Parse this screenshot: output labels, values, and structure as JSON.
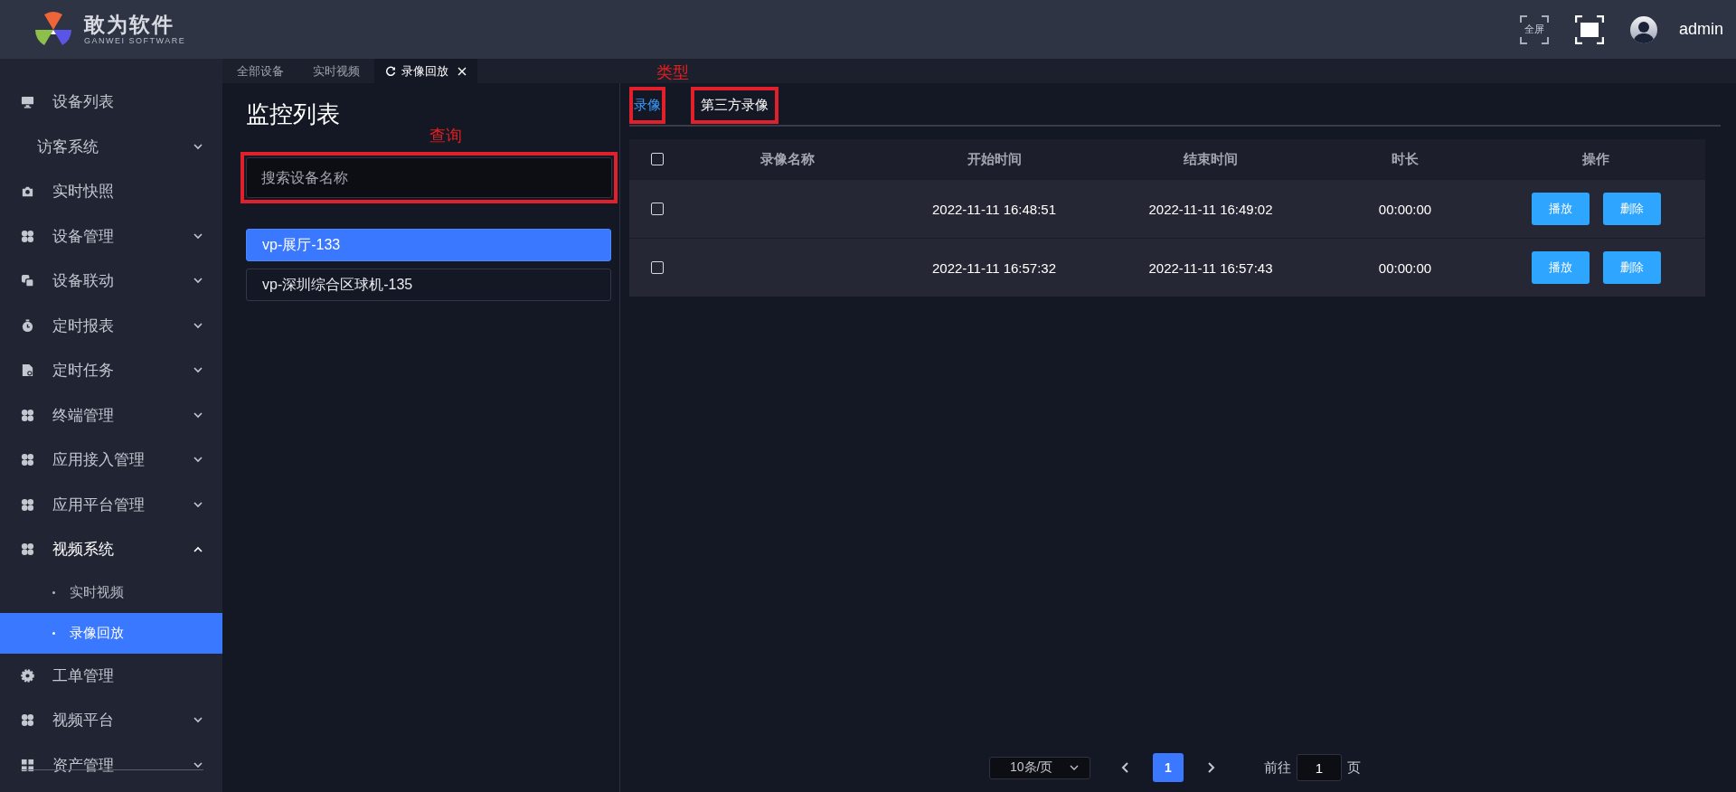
{
  "header": {
    "logo_title": "敢为软件",
    "logo_subtitle": "GANWEI SOFTWARE",
    "fullscreen_label": "全屏",
    "user": "admin"
  },
  "sidebar": {
    "items": [
      {
        "label": "设备列表",
        "expandable": false,
        "expanded": false
      },
      {
        "label": "访客系统",
        "expandable": true,
        "expanded": false
      },
      {
        "label": "实时快照",
        "expandable": false,
        "expanded": false
      },
      {
        "label": "设备管理",
        "expandable": true,
        "expanded": false
      },
      {
        "label": "设备联动",
        "expandable": true,
        "expanded": false
      },
      {
        "label": "定时报表",
        "expandable": true,
        "expanded": false
      },
      {
        "label": "定时任务",
        "expandable": true,
        "expanded": false
      },
      {
        "label": "终端管理",
        "expandable": true,
        "expanded": false
      },
      {
        "label": "应用接入管理",
        "expandable": true,
        "expanded": false
      },
      {
        "label": "应用平台管理",
        "expandable": true,
        "expanded": false
      },
      {
        "label": "视频系统",
        "expandable": true,
        "expanded": true,
        "children": [
          {
            "label": "实时视频",
            "selected": false
          },
          {
            "label": "录像回放",
            "selected": true
          }
        ]
      },
      {
        "label": "工单管理",
        "expandable": false,
        "expanded": false
      },
      {
        "label": "视频平台",
        "expandable": true,
        "expanded": false
      },
      {
        "label": "资产管理",
        "expandable": true,
        "expanded": false
      }
    ]
  },
  "tabs": [
    {
      "label": "全部设备",
      "selected": false
    },
    {
      "label": "实时视频",
      "selected": false
    },
    {
      "label": "录像回放",
      "selected": true
    }
  ],
  "left_panel": {
    "title": "监控列表",
    "annotation": "查询",
    "search": {
      "placeholder": "搜索设备名称",
      "highlighted": true
    },
    "devices": [
      {
        "label": "vp-展厅-133",
        "selected": true
      },
      {
        "label": "vp-深圳综合区球机-135",
        "selected": false
      }
    ]
  },
  "right_panel": {
    "annotation": "类型",
    "type_tabs": [
      {
        "label": "录像",
        "selected": true,
        "highlighted": true
      },
      {
        "label": "第三方录像",
        "selected": false,
        "highlighted": true
      }
    ],
    "table": {
      "select_all_checked": false,
      "columns": [
        "录像名称",
        "开始时间",
        "结束时间",
        "时长",
        "操作"
      ],
      "rows": [
        {
          "checked": false,
          "start": "2022-11-11 16:48:51",
          "end": "2022-11-11 16:49:02",
          "duration": "00:00:00",
          "actions": [
            "播放",
            "删除"
          ]
        },
        {
          "checked": false,
          "start": "2022-11-11 16:57:32",
          "end": "2022-11-11 16:57:43",
          "duration": "00:00:00",
          "actions": [
            "播放",
            "删除"
          ]
        }
      ]
    },
    "pagination": {
      "page_size": "10条/页",
      "pages": [
        {
          "label": "1",
          "selected": true
        }
      ],
      "goto_label": "前往",
      "goto_value": "1",
      "page_suffix": "页"
    }
  }
}
